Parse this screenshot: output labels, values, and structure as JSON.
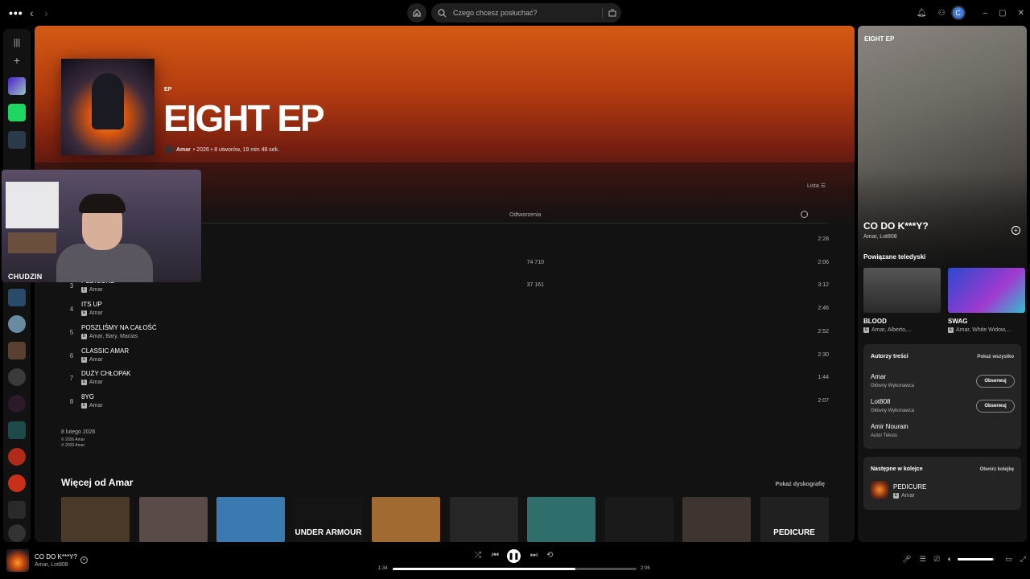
{
  "topbar": {
    "menu_icon": "more-dots",
    "back_icon": "chevron-left",
    "forward_icon": "chevron-right",
    "home_icon": "home",
    "search_placeholder": "Czego chcesz posłuchać?",
    "browse_icon": "browse",
    "notification_icon": "bell",
    "friends_icon": "users",
    "avatar_letter": "C",
    "window_controls": [
      "–",
      "▢",
      "✕"
    ]
  },
  "sidebar": {
    "library_icon": "library",
    "create_icon": "plus"
  },
  "album": {
    "type": "EP",
    "title": "EIGHT EP",
    "artist": "Amar",
    "details": "• 2026 • 8 utworów, 19 min 48 sek.",
    "view_label": "Lista",
    "column_plays": "Odtworzenia"
  },
  "tracks": [
    {
      "num": "",
      "title": "",
      "artist": "",
      "plays": "",
      "duration": "2:28"
    },
    {
      "num": "",
      "title": "",
      "artist": "",
      "plays": "74 710",
      "duration": "2:06"
    },
    {
      "num": "3",
      "title": "PEDICURE",
      "artist": "Amar",
      "plays": "37 161",
      "duration": "3:12"
    },
    {
      "num": "4",
      "title": "ITS UP",
      "artist": "Amar",
      "plays": "",
      "duration": "2:46"
    },
    {
      "num": "5",
      "title": "POSZLIŚMY NA CAŁOŚĆ",
      "artist": "Amar, Bary, Macias",
      "plays": "",
      "duration": "2:52"
    },
    {
      "num": "6",
      "title": "CLASSIC AMAR",
      "artist": "Amar",
      "plays": "",
      "duration": "2:30"
    },
    {
      "num": "7",
      "title": "DUŻY CHŁOPAK",
      "artist": "Amar",
      "plays": "",
      "duration": "1:44"
    },
    {
      "num": "8",
      "title": "8YG",
      "artist": "Amar",
      "plays": "",
      "duration": "2:07"
    }
  ],
  "release": {
    "date": "8 lutego 2026",
    "copyright_c": "© 2026 Amar",
    "copyright_p": "℗ 2026 Amar"
  },
  "more": {
    "title": "Więcej od Amar",
    "link": "Pokaż dyskografię",
    "cards": [
      {
        "label": "",
        "color": "#4a3a2a"
      },
      {
        "label": "",
        "color": "#5a4a48"
      },
      {
        "label": "",
        "color": "#3a7ab0"
      },
      {
        "label": "UNDER ARMOUR",
        "color": "#141414"
      },
      {
        "label": "",
        "color": "#a06a30"
      },
      {
        "label": "",
        "color": "#262626"
      },
      {
        "label": "",
        "color": "#2f6e6a"
      },
      {
        "label": "",
        "color": "#1a1a1a"
      },
      {
        "label": "",
        "color": "#3e3430"
      },
      {
        "label": "PEDICURE",
        "color": "#202020"
      }
    ]
  },
  "webcam": {
    "label": "CHUDZIN"
  },
  "right_panel": {
    "title": "EIGHT EP",
    "song": "CO DO K***Y?",
    "artist": "Amar, Lot808",
    "videos_header": "Powiązane teledyski",
    "videos": [
      {
        "title": "BLOOD",
        "artists": "Amar, Alberto,...",
        "color": "#3a3a3a"
      },
      {
        "title": "SWAG",
        "artists": "Amar, White Widow,...",
        "color": "#5a34c0"
      }
    ],
    "credits_header": "Autorzy treści",
    "credits_link": "Pokaż wszystko",
    "credits": [
      {
        "name": "Amar",
        "role": "Główny Wykonawca",
        "follow": "Obserwuj"
      },
      {
        "name": "Lot808",
        "role": "Główny Wykonawca",
        "follow": "Obserwuj"
      },
      {
        "name": "Amir Nourain",
        "role": "Autor Tekstu",
        "follow": ""
      }
    ],
    "queue_header": "Następne w kolejce",
    "queue_link": "Otwórz kolejkę",
    "queue_title": "PEDICURE",
    "queue_artist": "Amar"
  },
  "player": {
    "title": "CO DO K***Y?",
    "artist": "Amar, Lot808",
    "elapsed": "1:34",
    "total": "2:06",
    "progress": 0.75,
    "volume": 0.95
  },
  "colors": {
    "accent": "#d35a14",
    "background": "#121212",
    "text": "#ffffff",
    "muted": "#b3b3b3"
  }
}
